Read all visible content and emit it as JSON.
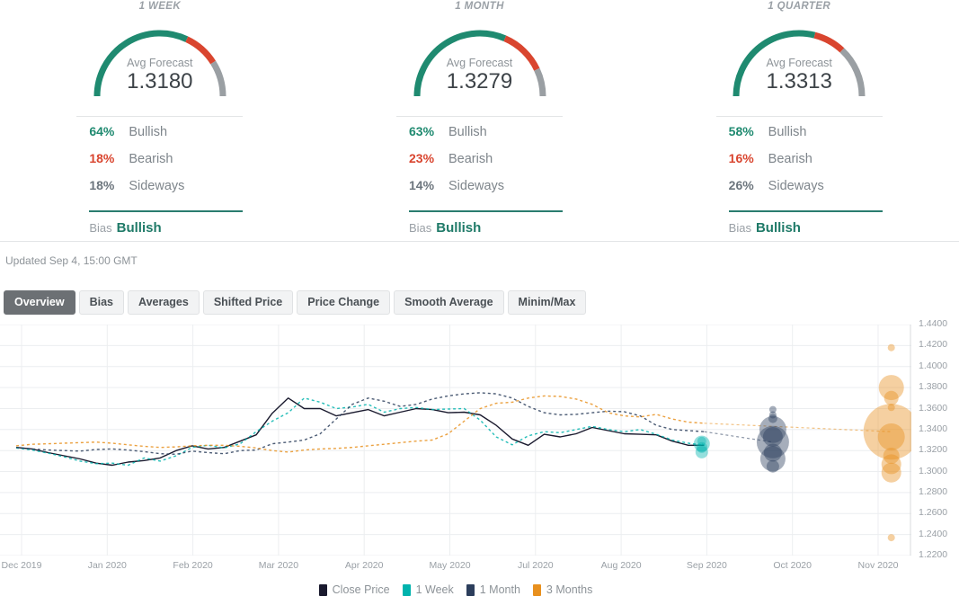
{
  "panels": [
    {
      "title": "1 WEEK",
      "caption": "Avg Forecast",
      "value": "1.3180",
      "bullish_pct": "64%",
      "bullish_label": "Bullish",
      "bearish_pct": "18%",
      "bearish_label": "Bearish",
      "sideways_pct": "18%",
      "sideways_label": "Sideways",
      "bias_label": "Bias",
      "bias_value": "Bullish",
      "bullish_num": 64,
      "bearish_num": 18,
      "sideways_num": 18
    },
    {
      "title": "1 MONTH",
      "caption": "Avg Forecast",
      "value": "1.3279",
      "bullish_pct": "63%",
      "bullish_label": "Bullish",
      "bearish_pct": "23%",
      "bearish_label": "Bearish",
      "sideways_pct": "14%",
      "sideways_label": "Sideways",
      "bias_label": "Bias",
      "bias_value": "Bullish",
      "bullish_num": 63,
      "bearish_num": 23,
      "sideways_num": 14
    },
    {
      "title": "1 QUARTER",
      "caption": "Avg Forecast",
      "value": "1.3313",
      "bullish_pct": "58%",
      "bullish_label": "Bullish",
      "bearish_pct": "16%",
      "bearish_label": "Bearish",
      "sideways_pct": "26%",
      "sideways_label": "Sideways",
      "bias_label": "Bias",
      "bias_value": "Bullish",
      "bullish_num": 58,
      "bearish_num": 16,
      "sideways_num": 26
    }
  ],
  "updated_text": "Updated Sep 4, 15:00 GMT",
  "tabs": [
    {
      "label": "Overview",
      "active": true
    },
    {
      "label": "Bias",
      "active": false
    },
    {
      "label": "Averages",
      "active": false
    },
    {
      "label": "Shifted Price",
      "active": false
    },
    {
      "label": "Price Change",
      "active": false
    },
    {
      "label": "Smooth Average",
      "active": false
    },
    {
      "label": "Minim/Max",
      "active": false
    }
  ],
  "colors": {
    "bullish": "#1f8a70",
    "bearish": "#d9452f",
    "neutral": "#9a9fa3",
    "close_price": "#1a1a2e",
    "one_week": "#00b3ad",
    "one_month": "#2c3e5c",
    "three_months": "#e8901e",
    "tab_active_bg": "#6c7074"
  },
  "chart_data": {
    "type": "line",
    "title": "",
    "xlabel": "",
    "ylabel": "",
    "grid": true,
    "legend_position": "bottom",
    "ylim": [
      1.22,
      1.44
    ],
    "yticks": [
      "1.4400",
      "1.4200",
      "1.4000",
      "1.3800",
      "1.3600",
      "1.3400",
      "1.3200",
      "1.3000",
      "1.2800",
      "1.2600",
      "1.2400",
      "1.2200"
    ],
    "xticks": [
      "Dec 2019",
      "Jan 2020",
      "Feb 2020",
      "Mar 2020",
      "Apr 2020",
      "May 2020",
      "Jul 2020",
      "Aug 2020",
      "Sep 2020",
      "Oct 2020",
      "Nov 2020"
    ],
    "series": [
      {
        "name": "Close Price",
        "color": "#1a1a2e",
        "style": "solid",
        "values": [
          1.323,
          1.3215,
          1.318,
          1.315,
          1.312,
          1.308,
          1.306,
          1.309,
          1.3105,
          1.313,
          1.32,
          1.3245,
          1.3215,
          1.323,
          1.329,
          1.335,
          1.3555,
          1.37,
          1.36,
          1.36,
          1.353,
          1.356,
          1.359,
          1.353,
          1.3565,
          1.36,
          1.359,
          1.356,
          1.3565,
          1.354,
          1.344,
          1.331,
          1.325,
          1.3355,
          1.333,
          1.336,
          1.342,
          1.339,
          1.336,
          1.3355,
          1.335,
          1.329,
          1.325,
          1.325
        ]
      },
      {
        "name": "1 Week",
        "color": "#00b3ad",
        "style": "dotted",
        "values": [
          1.3225,
          1.3205,
          1.3175,
          1.314,
          1.31,
          1.3075,
          1.308,
          1.306,
          1.313,
          1.31,
          1.315,
          1.323,
          1.325,
          1.3225,
          1.3265,
          1.338,
          1.348,
          1.356,
          1.37,
          1.366,
          1.36,
          1.3615,
          1.364,
          1.3565,
          1.36,
          1.361,
          1.359,
          1.3595,
          1.36,
          1.349,
          1.333,
          1.3255,
          1.334,
          1.338,
          1.337,
          1.34,
          1.343,
          1.34,
          1.338,
          1.34,
          1.3355,
          1.33,
          1.327,
          1.325
        ]
      },
      {
        "name": "1 Month",
        "color": "#2c3e5c",
        "style": "dotted",
        "values": [
          1.323,
          1.3215,
          1.3205,
          1.32,
          1.3195,
          1.321,
          1.3215,
          1.3205,
          1.319,
          1.317,
          1.3165,
          1.3195,
          1.318,
          1.317,
          1.32,
          1.3205,
          1.3265,
          1.328,
          1.33,
          1.336,
          1.35,
          1.364,
          1.37,
          1.367,
          1.362,
          1.364,
          1.369,
          1.372,
          1.374,
          1.375,
          1.374,
          1.37,
          1.362,
          1.356,
          1.354,
          1.3545,
          1.356,
          1.3575,
          1.357,
          1.353,
          1.344,
          1.34,
          1.339,
          1.338
        ]
      },
      {
        "name": "3 Months",
        "color": "#e8901e",
        "style": "dotted",
        "values": [
          1.3245,
          1.326,
          1.3265,
          1.327,
          1.3275,
          1.328,
          1.327,
          1.3255,
          1.324,
          1.323,
          1.3235,
          1.3245,
          1.325,
          1.325,
          1.324,
          1.3225,
          1.32,
          1.3185,
          1.3205,
          1.3215,
          1.322,
          1.323,
          1.3245,
          1.326,
          1.3275,
          1.329,
          1.33,
          1.336,
          1.348,
          1.36,
          1.365,
          1.366,
          1.37,
          1.372,
          1.3715,
          1.369,
          1.364,
          1.356,
          1.353,
          1.352,
          1.3545,
          1.35,
          1.347,
          1.346
        ]
      }
    ],
    "bubbles": [
      {
        "series": "1 Week",
        "x": 0.77,
        "y": 1.329,
        "r": 5
      },
      {
        "series": "1 Week",
        "x": 0.77,
        "y": 1.3265,
        "r": 9
      },
      {
        "series": "1 Week",
        "x": 0.77,
        "y": 1.323,
        "r": 6
      },
      {
        "series": "1 Week",
        "x": 0.77,
        "y": 1.3185,
        "r": 7
      },
      {
        "series": "1 Month",
        "x": 0.848,
        "y": 1.359,
        "r": 4
      },
      {
        "series": "1 Month",
        "x": 0.848,
        "y": 1.354,
        "r": 4
      },
      {
        "series": "1 Month",
        "x": 0.848,
        "y": 1.3505,
        "r": 5
      },
      {
        "series": "1 Month",
        "x": 0.848,
        "y": 1.34,
        "r": 15
      },
      {
        "series": "1 Month",
        "x": 0.848,
        "y": 1.333,
        "r": 11
      },
      {
        "series": "1 Month",
        "x": 0.848,
        "y": 1.328,
        "r": 18
      },
      {
        "series": "1 Month",
        "x": 0.848,
        "y": 1.318,
        "r": 10
      },
      {
        "series": "1 Month",
        "x": 0.848,
        "y": 1.312,
        "r": 14
      },
      {
        "series": "1 Month",
        "x": 0.848,
        "y": 1.305,
        "r": 7
      },
      {
        "series": "3 Months",
        "x": 0.978,
        "y": 1.418,
        "r": 4
      },
      {
        "series": "3 Months",
        "x": 0.978,
        "y": 1.38,
        "r": 14
      },
      {
        "series": "3 Months",
        "x": 0.978,
        "y": 1.37,
        "r": 8
      },
      {
        "series": "3 Months",
        "x": 0.978,
        "y": 1.361,
        "r": 4
      },
      {
        "series": "3 Months",
        "x": 0.978,
        "y": 1.338,
        "r": 31
      },
      {
        "series": "3 Months",
        "x": 0.978,
        "y": 1.333,
        "r": 15
      },
      {
        "series": "3 Months",
        "x": 0.978,
        "y": 1.315,
        "r": 9
      },
      {
        "series": "3 Months",
        "x": 0.978,
        "y": 1.307,
        "r": 11
      },
      {
        "series": "3 Months",
        "x": 0.978,
        "y": 1.299,
        "r": 11
      },
      {
        "series": "3 Months",
        "x": 0.978,
        "y": 1.237,
        "r": 4
      }
    ],
    "legend": [
      {
        "label": "Close Price",
        "color": "#1a1a2e"
      },
      {
        "label": "1 Week",
        "color": "#00b3ad"
      },
      {
        "label": "1 Month",
        "color": "#2c3e5c"
      },
      {
        "label": "3 Months",
        "color": "#e8901e"
      }
    ]
  }
}
